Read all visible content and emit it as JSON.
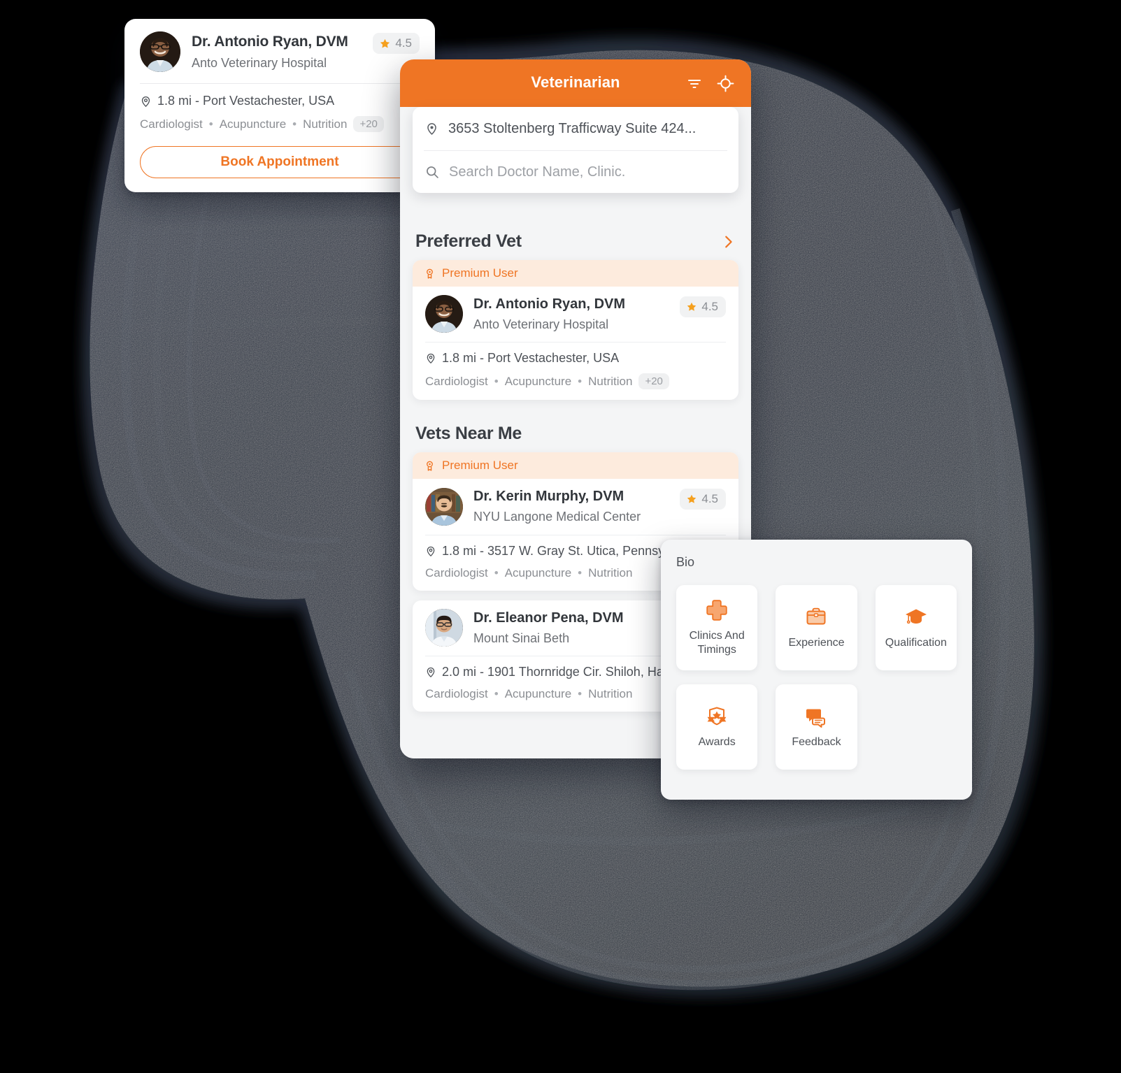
{
  "colors": {
    "brand_orange": "#ef7524",
    "premium_bg": "#fdebdd",
    "screen_bg": "#f4f5f6",
    "blob_navy": "#2a3242",
    "page_bg": "#000000",
    "text_dark": "#32363b",
    "text_muted": "#6d7075"
  },
  "floating_card": {
    "doctor_name": "Dr. Antonio Ryan, DVM",
    "clinic": "Anto Veterinary Hospital",
    "rating": "4.5",
    "location": "1.8 mi - Port Vestachester, USA",
    "tags": [
      "Cardiologist",
      "Acupuncture",
      "Nutrition"
    ],
    "tags_more": "+20",
    "book_label": "Book Appointment"
  },
  "phone": {
    "header": {
      "title": "Veterinarian",
      "filter_icon": "filter-icon",
      "locate_icon": "crosshair-icon"
    },
    "search": {
      "address_value": "3653 Stoltenberg Trafficway Suite 424...",
      "address_icon": "location-pin-icon",
      "search_placeholder": "Search Doctor Name, Clinic.",
      "search_icon": "search-icon"
    },
    "sections": [
      {
        "title": "Preferred Vet",
        "has_chevron": true,
        "chevron_icon": "chevron-right-icon",
        "cards": [
          {
            "premium": true,
            "premium_label": "Premium User",
            "premium_icon": "medal-icon",
            "doctor_name": "Dr. Antonio Ryan, DVM",
            "clinic": "Anto Veterinary Hospital",
            "rating": "4.5",
            "location": "1.8 mi - Port Vestachester, USA",
            "tags": [
              "Cardiologist",
              "Acupuncture",
              "Nutrition"
            ],
            "tags_more": "+20"
          }
        ]
      },
      {
        "title": "Vets Near Me",
        "has_chevron": false,
        "cards": [
          {
            "premium": true,
            "premium_label": "Premium User",
            "premium_icon": "medal-icon",
            "doctor_name": "Dr. Kerin Murphy, DVM",
            "clinic": "NYU Langone Medical Center",
            "rating": "4.5",
            "location": "1.8 mi - 3517 W. Gray St. Utica, Pennsy",
            "tags": [
              "Cardiologist",
              "Acupuncture",
              "Nutrition"
            ],
            "tags_more": ""
          },
          {
            "premium": false,
            "doctor_name": "Dr. Eleanor Pena, DVM",
            "clinic": "Mount Sinai Beth",
            "rating": "",
            "location": "2.0 mi - 1901 Thornridge Cir. Shiloh, Ha",
            "tags": [
              "Cardiologist",
              "Acupuncture",
              "Nutrition"
            ],
            "tags_more": ""
          }
        ]
      }
    ]
  },
  "bio_panel": {
    "label": "Bio",
    "tiles": [
      {
        "label": "Clinics And Timings",
        "icon": "plus-cross-icon"
      },
      {
        "label": "Experience",
        "icon": "briefcase-icon"
      },
      {
        "label": "Qualification",
        "icon": "graduation-cap-icon"
      },
      {
        "label": "Awards",
        "icon": "award-shield-icon"
      },
      {
        "label": "Feedback",
        "icon": "chat-bubbles-icon"
      }
    ]
  }
}
